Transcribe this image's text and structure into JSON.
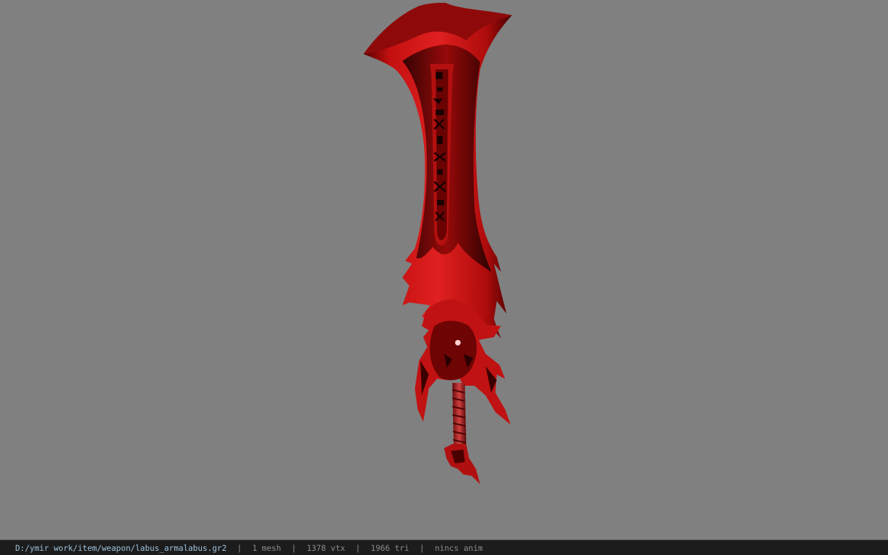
{
  "viewport": {
    "background": "#808080",
    "model_color": "#c81616",
    "model_shadow": "#3a0000"
  },
  "statusbar": {
    "file_path": "D:/ymir work/item/weapon/labus_armalabus.gr2",
    "separator": "|",
    "mesh_count": "1 mesh",
    "vertex_count": "1378 vtx",
    "triangle_count": "1966 tri",
    "anim_status": "nincs anim"
  }
}
